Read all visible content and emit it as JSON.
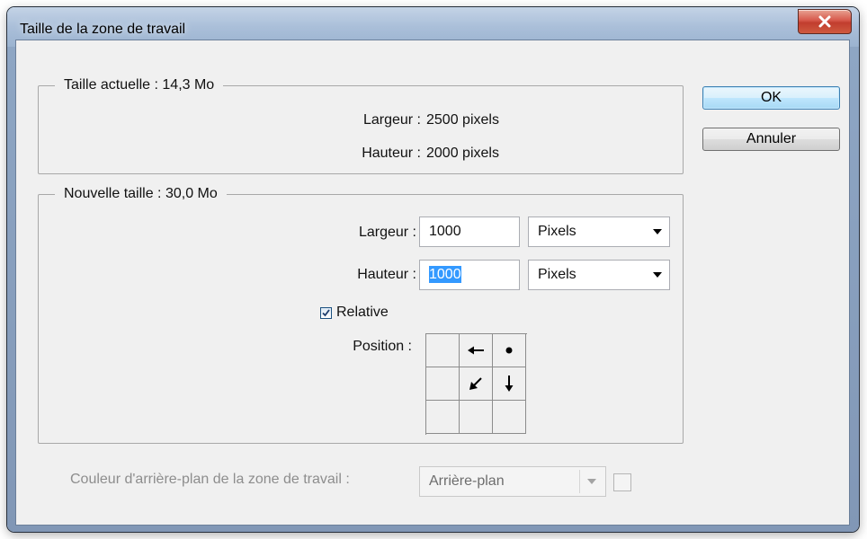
{
  "window": {
    "title": "Taille de la zone de travail"
  },
  "current_size": {
    "legend": "Taille actuelle : 14,3 Mo",
    "width_label": "Largeur :",
    "width_value": "2500 pixels",
    "height_label": "Hauteur :",
    "height_value": "2000 pixels"
  },
  "new_size": {
    "legend": "Nouvelle taille : 30,0 Mo",
    "width_label": "Largeur :",
    "width_value": "1000",
    "width_unit": "Pixels",
    "height_label": "Hauteur :",
    "height_value": "1000",
    "height_unit": "Pixels",
    "relative_label": "Relative",
    "relative_checked": true,
    "position_label": "Position :",
    "anchor_grid": [
      [
        "",
        "arrow-left-icon",
        "dot-icon"
      ],
      [
        "",
        "arrow-down-left-icon",
        "arrow-down-icon"
      ],
      [
        "",
        "",
        ""
      ]
    ]
  },
  "background": {
    "label": "Couleur d'arrière-plan de la zone de travail :",
    "value": "Arrière-plan",
    "enabled": false
  },
  "buttons": {
    "ok_label": "OK",
    "cancel_label": "Annuler"
  },
  "colors": {
    "selection": "#3399ff",
    "default_button_border": "#3c7fb1",
    "close_button": "#c13d2e",
    "disabled_text": "#8d8d8d"
  }
}
